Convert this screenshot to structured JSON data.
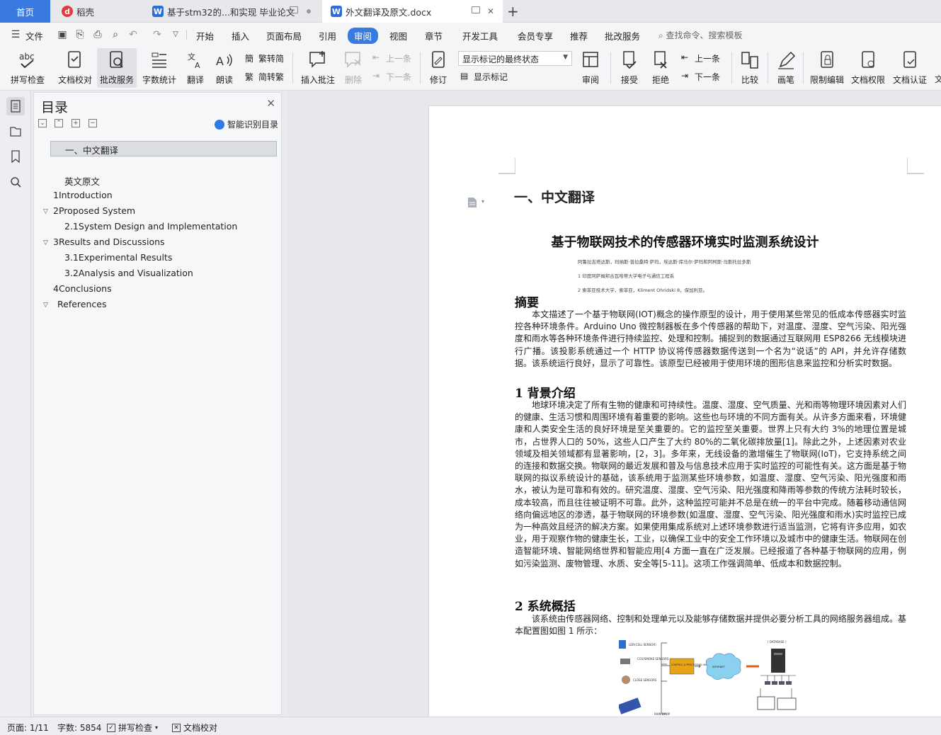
{
  "tabs": [
    {
      "label": "首页"
    },
    {
      "label": "稻壳"
    },
    {
      "label": "基于stm32的...和实现 毕业论文"
    },
    {
      "label": "外文翻译及原文.docx"
    }
  ],
  "menu": {
    "file": "文件",
    "items": [
      "开始",
      "插入",
      "页面布局",
      "引用",
      "审阅",
      "视图",
      "章节",
      "开发工具",
      "会员专享",
      "推荐",
      "批改服务"
    ],
    "active": "审阅",
    "search_placeholder": "查找命令、搜索模板"
  },
  "ribbon": {
    "spellcheck": "拼写检查",
    "doc_proof": "文档校对",
    "review_service": "批改服务",
    "word_count": "字数统计",
    "translate": "翻译",
    "read_aloud": "朗读",
    "trad_to_simp": "繁转简",
    "simp_to_trad": "简转繁",
    "insert_comment": "插入批注",
    "delete": "删除",
    "prev": "上一条",
    "next": "下一条",
    "track": "修订",
    "markup_select": "显示标记的最终状态",
    "show_markup": "显示标记",
    "review": "审阅",
    "accept": "接受",
    "reject": "拒绝",
    "prev2": "上一条",
    "next2": "下一条",
    "compare": "比较",
    "pen": "画笔",
    "restrict_edit": "限制编辑",
    "doc_permission": "文档权限",
    "doc_cert": "文档认证",
    "more": "文"
  },
  "toc": {
    "title": "目录",
    "smart_label": "智能识别目录",
    "items": [
      {
        "label": "一、中文翻译"
      },
      {
        "label": "英文原文"
      },
      {
        "label": "1Introduction"
      },
      {
        "label": "2Proposed System"
      },
      {
        "label": "2.1System Design and Implementation"
      },
      {
        "label": "3Results and Discussions"
      },
      {
        "label": "3.1Experimental Results"
      },
      {
        "label": "3.2Analysis and Visualization"
      },
      {
        "label": "4Conclusions"
      },
      {
        "label": "References"
      }
    ]
  },
  "document": {
    "heading": "一、中文翻译",
    "paper_title": "基于物联网技术的传感器环境实时监测系统设计",
    "authors": "阿鲁拉吉塔达斯，玛纳斯·普拉桑特·萨玛，埃达斯·库马尔·萨玛和阿柯斯·马斯托拉多斯",
    "affil1": "1 印度阿萨姆邦古瓦哈蒂大学电子与通信工程系",
    "affil2": "2 索菲亚技术大学，索菲亚，Kliment Ohridski 8，保加利亚。",
    "abstract_h": "摘要",
    "abstract": "本文描述了一个基于物联网(IOT)概念的操作原型的设计，用于使用某些常见的低成本传感器实时监控各种环境条件。Arduino Uno 微控制器板在多个传感器的帮助下，对温度、湿度、空气污染、阳光强度和雨水等各种环境条件进行持续监控、处理和控制。捕捉到的数据通过互联网用 ESP8266 无线模块进行广播。该投影系统通过一个 HTTP 协议将传感器数据传送到一个名为“说话”的 API，并允许存储数据。该系统运行良好，显示了可靠性。该原型已经被用于使用环境的图形信息来监控和分析实时数据。",
    "sec1_h": "1 背景介绍",
    "sec1": "地球环境决定了所有生物的健康和可持续性。温度、湿度、空气质量、光和雨等物理环境因素对人们的健康、生活习惯和周围环境有着重要的影响。这些也与环境的不同方面有关。从许多方面来看，环境健康和人类安全生活的良好环境是至关重要的。它的监控至关重要。世界上只有大约 3%的地理位置是城市，占世界人口的 50%，这些人口产生了大约 80%的二氧化碳排放量[1]。除此之外，上述因素对农业领域及相关领域都有显著影响，[2，3]。多年来，无线设备的激增催生了物联网(IoT)，它支持系统之间的连接和数据交换。物联网的最近发展和普及与信息技术应用于实时监控的可能性有关。这方面是基于物联网的拟议系统设计的基础，该系统用于监测某些环境参数，如温度、湿度、空气污染、阳光强度和雨水，被认为是可靠和有效的。研究温度、湿度、空气污染、阳光强度和降雨等参数的传统方法耗时较长，成本较高，而且往往被证明不可靠。此外，这种监控可能并不总是在统一的平台中完成。随着移动通信网络向偏远地区的渗透，基于物联网的环境参数(如温度、湿度、空气污染、阳光强度和雨水)实时监控已成为一种高效且经济的解决方案。如果使用集成系统对上述环境参数进行适当监测，它将有许多应用，如农业，用于观察作物的健康生长，工业，以确保工业中的安全工作环境以及城市中的健康生活。物联网在创造智能环境、智能网络世界和智能应用[4 方面一直在广泛发展。已经报道了各种基于物联网的应用，例如污染监测、废物管理、水质、安全等[5-11]。这项工作强调简单、低成本和数据控制。",
    "sec2_h": "2 系统概括",
    "sec2": "该系统由传感器网络、控制和处理单元以及能够存储数据并提供必要分析工具的网络服务器组成。基本配置图如图 1 所示："
  },
  "figure": {
    "labels": [
      "LDR(CELL SENSOR)",
      "CO2/SMOKE SENSORS",
      "CLOSE SENSORS",
      "RAIN DROP",
      "CONTROL & PROCESSING UNIT",
      "INTERNET",
      "( DATABASE )"
    ]
  },
  "status": {
    "page": "页面: 1/11",
    "words": "字数: 5854",
    "spell": "拼写检查",
    "proof": "文档校对"
  }
}
